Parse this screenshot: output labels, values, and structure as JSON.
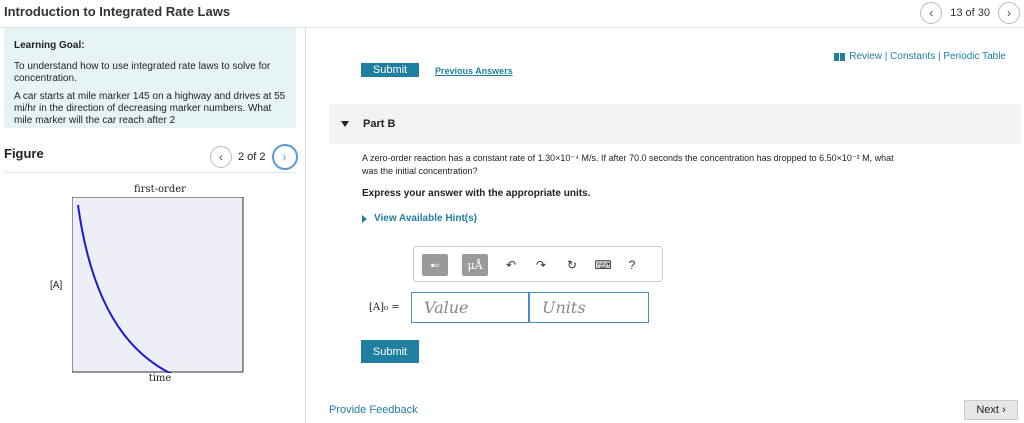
{
  "header": {
    "title": "Introduction to Integrated Rate Laws",
    "pager_text": "13 of 30",
    "prev_icon": "‹",
    "next_icon": "›"
  },
  "learning_goal": {
    "heading": "Learning Goal:",
    "text1": "To understand how to use integrated rate laws to solve for concentration.",
    "text2": "A car starts at mile marker 145 on a highway and drives at 55 mi/hr in the direction of decreasing marker numbers. What mile marker will the car reach after 2"
  },
  "figure": {
    "label": "Figure",
    "nav_text": "2 of 2",
    "graph_title": "first-order",
    "y_label": "[A]",
    "x_label": "time",
    "curve_color": "#1a1ad6",
    "plot_bg": "#eeeef6"
  },
  "right": {
    "submit_top": "Submit",
    "previous_answers": "Previous Answers",
    "review_links": "Review | Constants | Periodic Table",
    "part_label": "Part B",
    "question_line1": "A zero-order reaction has a constant rate of 1.30×10⁻⁴ M/s. If after 70.0 seconds the concentration has dropped to 6.50×10⁻² M, what",
    "question_line2": "was the initial concentration?",
    "instruction": "Express your answer with the appropriate units.",
    "hints": "View Available Hint(s)",
    "toolbar": {
      "templates_icon": "▪▫",
      "units_label": "μÅ",
      "undo_icon": "↶",
      "redo_icon": "↷",
      "reset_icon": "↻",
      "keyboard_icon": "⌨",
      "help_icon": "?"
    },
    "answer_label": "[A]₀ =",
    "value_placeholder": "Value",
    "units_placeholder": "Units",
    "submit": "Submit",
    "feedback": "Provide Feedback",
    "next": "Next",
    "next_icon": "›",
    "accent": "#1f7fa0"
  }
}
